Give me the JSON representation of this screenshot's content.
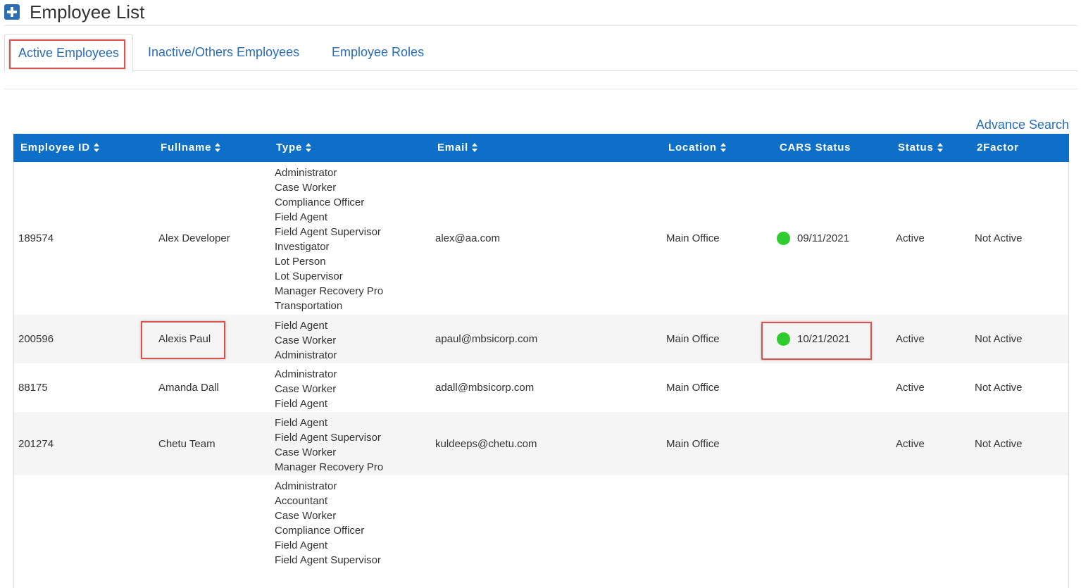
{
  "header": {
    "title": "Employee List",
    "icon": "plus-square-icon"
  },
  "tabs": [
    {
      "label": "Active Employees",
      "active": true
    },
    {
      "label": "Inactive/Others Employees",
      "active": false
    },
    {
      "label": "Employee Roles",
      "active": false
    }
  ],
  "advance_search_label": "Advance Search",
  "table": {
    "columns": [
      "Employee ID",
      "Fullname",
      "Type",
      "Email",
      "Location",
      "CARS Status",
      "Status",
      "2Factor"
    ],
    "rows": [
      {
        "id": "189574",
        "name": "Alex Developer",
        "types": [
          "Administrator",
          "Case Worker",
          "Compliance Officer",
          "Field Agent",
          "Field Agent Supervisor",
          "Investigator",
          "Lot Person",
          "Lot Supervisor",
          "Manager Recovery Pro",
          "Transportation"
        ],
        "email": "alex@aa.com",
        "location": "Main Office",
        "cars_date": "09/11/2021",
        "status": "Active",
        "twofactor": "Not Active"
      },
      {
        "id": "200596",
        "name": "Alexis Paul",
        "types": [
          "Field Agent",
          "Case Worker",
          "Administrator"
        ],
        "email": "apaul@mbsicorp.com",
        "location": "Main Office",
        "cars_date": "10/21/2021",
        "status": "Active",
        "twofactor": "Not Active"
      },
      {
        "id": "88175",
        "name": "Amanda Dall",
        "types": [
          "Administrator",
          "Case Worker",
          "Field Agent"
        ],
        "email": "adall@mbsicorp.com",
        "location": "Main Office",
        "cars_date": "",
        "status": "Active",
        "twofactor": "Not Active"
      },
      {
        "id": "201274",
        "name": "Chetu Team",
        "types": [
          "Field Agent",
          "Field Agent Supervisor",
          "Case Worker",
          "Manager Recovery Pro"
        ],
        "email": "kuldeeps@chetu.com",
        "location": "Main Office",
        "cars_date": "",
        "status": "Active",
        "twofactor": "Not Active"
      },
      {
        "id": "",
        "name": "",
        "types": [
          "Administrator",
          "Accountant",
          "Case Worker",
          "Compliance Officer",
          "Field Agent",
          "Field Agent Supervisor"
        ],
        "email": "",
        "location": "",
        "cars_date": "",
        "status": "",
        "twofactor": ""
      }
    ]
  },
  "colors": {
    "header_bg": "#0d6fc8",
    "link": "#2a6db5",
    "status_green": "#2ecc2e",
    "highlight": "#d9534f"
  }
}
